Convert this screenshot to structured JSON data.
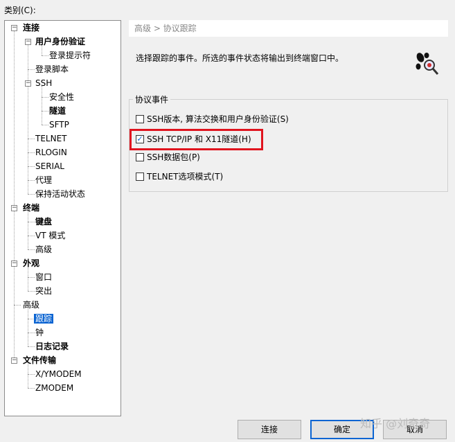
{
  "category_label": "类别(C):",
  "tree": {
    "nodes": [
      {
        "label": "连接",
        "bold": true
      },
      {
        "label": "用户身份验证",
        "bold": true
      },
      {
        "label": "登录提示符"
      },
      {
        "label": "登录脚本"
      },
      {
        "label": "SSH"
      },
      {
        "label": "安全性"
      },
      {
        "label": "隧道",
        "bold": true
      },
      {
        "label": "SFTP"
      },
      {
        "label": "TELNET"
      },
      {
        "label": "RLOGIN"
      },
      {
        "label": "SERIAL"
      },
      {
        "label": "代理"
      },
      {
        "label": "保持活动状态"
      },
      {
        "label": "终端",
        "bold": true
      },
      {
        "label": "键盘",
        "bold": true
      },
      {
        "label": "VT 模式"
      },
      {
        "label": "高级"
      },
      {
        "label": "外观",
        "bold": true
      },
      {
        "label": "窗口"
      },
      {
        "label": "突出"
      },
      {
        "label": "高级"
      },
      {
        "label": "跟踪",
        "selected": true
      },
      {
        "label": "钟"
      },
      {
        "label": "日志记录",
        "bold": true
      },
      {
        "label": "文件传输",
        "bold": true
      },
      {
        "label": "X/YMODEM"
      },
      {
        "label": "ZMODEM"
      }
    ]
  },
  "breadcrumb": "高级 > 协议跟踪",
  "description": "选择跟踪的事件。所选的事件状态将输出到终端窗口中。",
  "group": {
    "title": "协议事件",
    "items": [
      {
        "label": "SSH版本, 算法交换和用户身份验证(S)",
        "checked": false
      },
      {
        "label": "SSH TCP/IP 和 X11隧道(H)",
        "checked": true
      },
      {
        "label": "SSH数据包(P)",
        "checked": false
      },
      {
        "label": "TELNET选项模式(T)",
        "checked": false
      }
    ]
  },
  "buttons": {
    "connect": "连接",
    "ok": "确定",
    "cancel": "取消"
  },
  "watermark": "知乎 @刘奇奇",
  "colors": {
    "selection": "#0a64d2",
    "highlight": "#e0141e"
  }
}
